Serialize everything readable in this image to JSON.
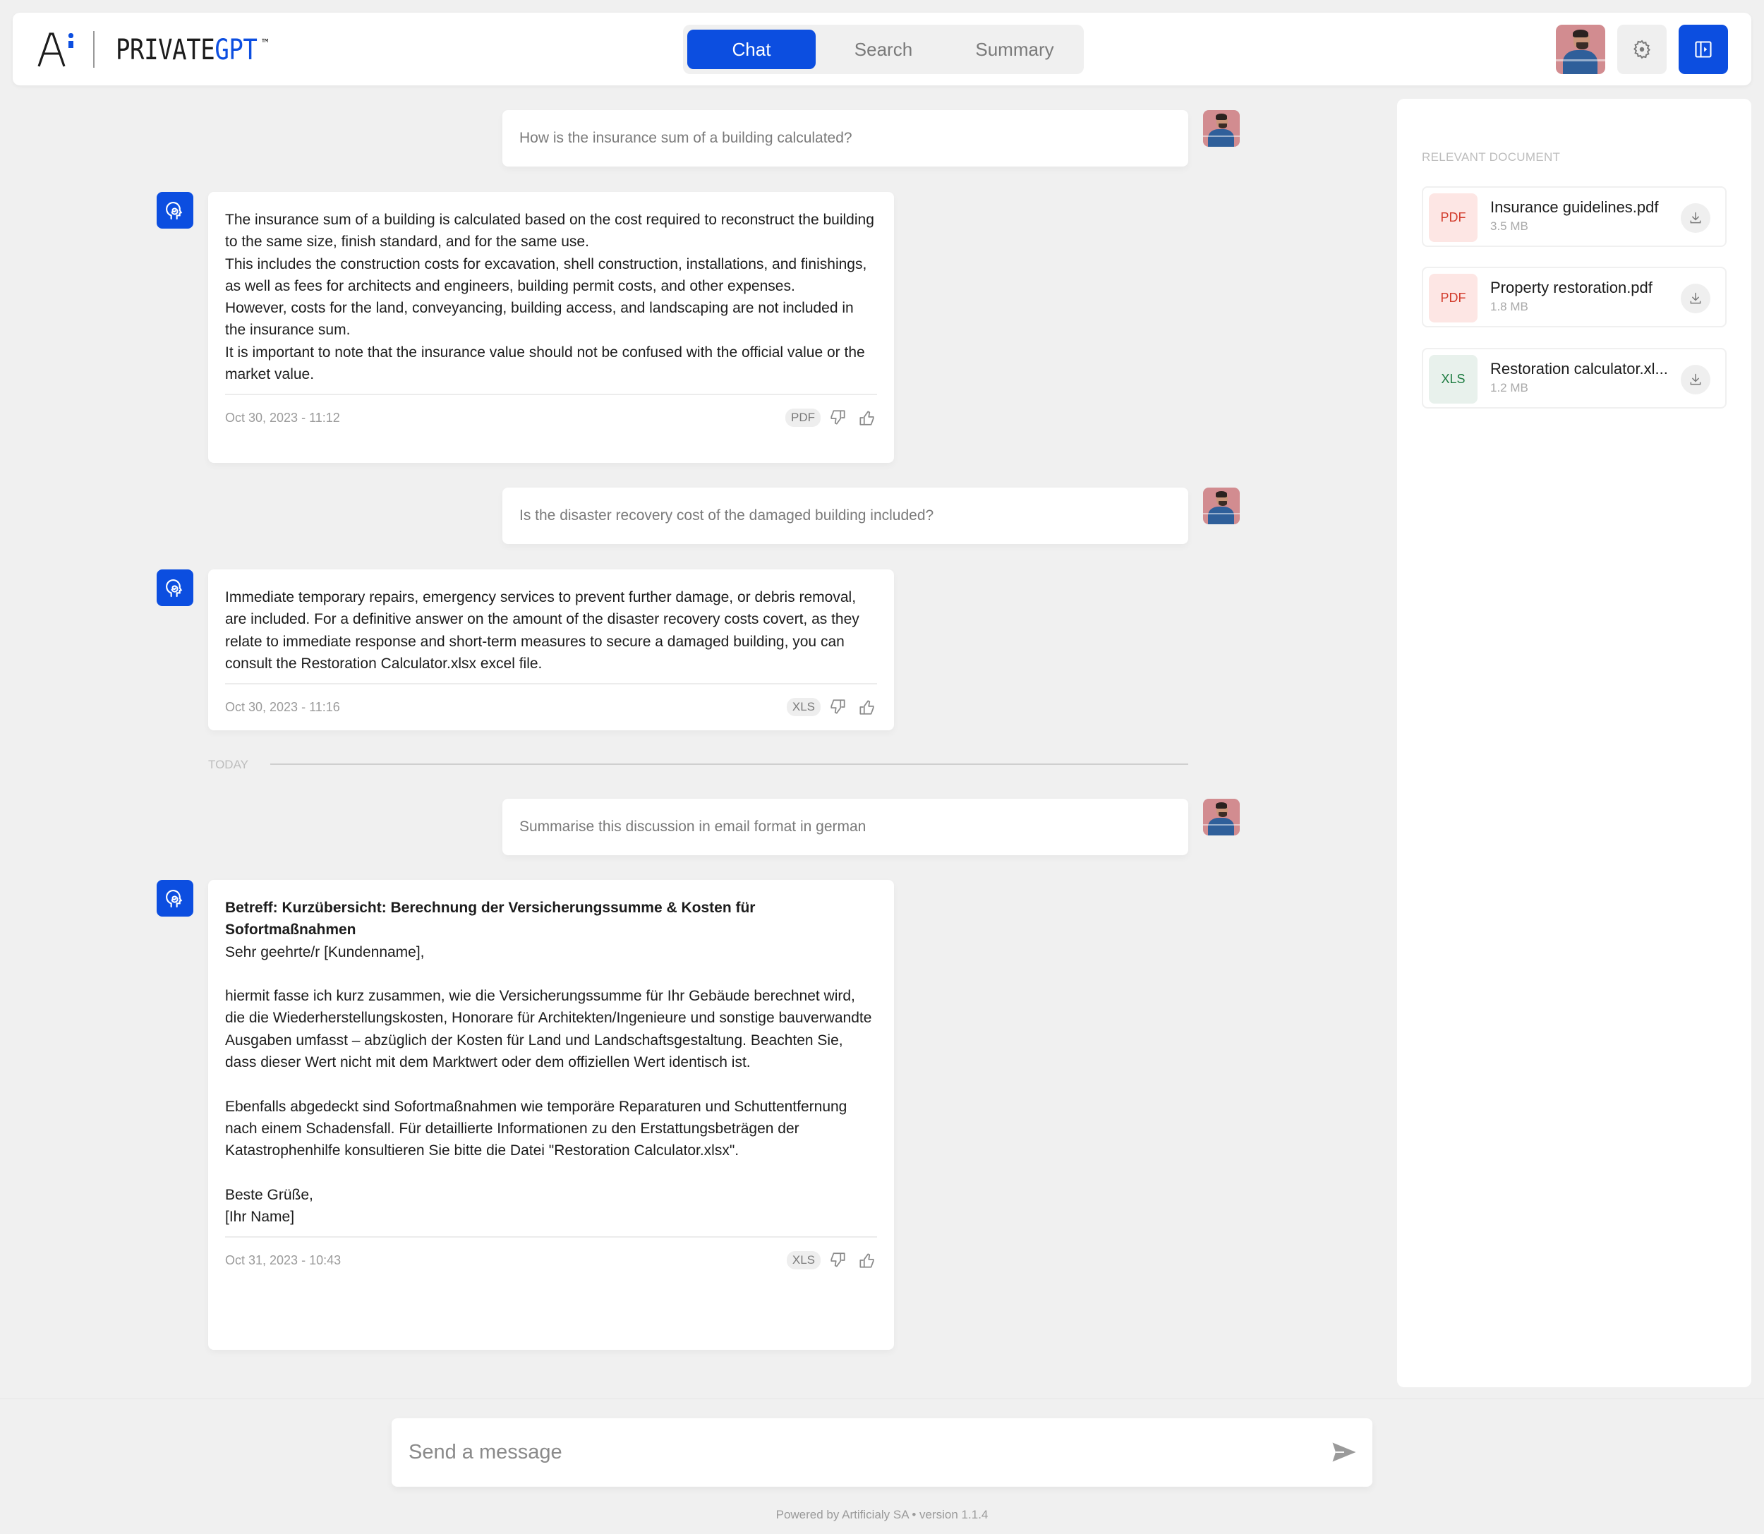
{
  "header": {
    "brand_part1": "PRIVATE",
    "brand_part2": "GPT",
    "brand_tm": "™",
    "tabs": [
      {
        "label": "Chat",
        "active": true
      },
      {
        "label": "Search",
        "active": false
      },
      {
        "label": "Summary",
        "active": false
      }
    ],
    "icons": {
      "settings": "gear-icon",
      "panel": "sidebar-toggle-icon"
    }
  },
  "colors": {
    "accent": "#0c4ee0",
    "background": "#f0f0f0",
    "pdf_bg": "#fde6e4",
    "pdf_text": "#d23a2a",
    "xls_bg": "#e8f1ec",
    "xls_text": "#1a7a3e"
  },
  "messages": [
    {
      "role": "user",
      "text": "How is the insurance sum of a building calculated?"
    },
    {
      "role": "assistant",
      "text": "The insurance sum of a building is calculated based on the cost required to reconstruct the building to the same size, finish standard, and for the same use.\nThis includes the construction costs for excavation, shell construction, installations, and finishings, as well as fees for architects and engineers, building permit costs, and other expenses.\nHowever, costs for the land, conveyancing, building access, and landscaping are not included in the insurance sum.\nIt is important to note that the insurance value should not be confused with the official value or the market value.",
      "timestamp": "Oct 30, 2023 - 11:12",
      "source_badge": "PDF"
    },
    {
      "role": "user",
      "text": "Is the disaster recovery cost of the damaged building included?"
    },
    {
      "role": "assistant",
      "text": "Immediate temporary repairs, emergency services to prevent further damage, or debris removal, are included. For a definitive answer on the amount of the disaster recovery costs covert, as they relate to immediate response and short-term measures to secure a damaged building, you can consult the Restoration Calculator.xlsx excel file.",
      "timestamp": "Oct 30, 2023 - 11:16",
      "source_badge": "XLS"
    },
    {
      "role": "divider",
      "text": "TODAY"
    },
    {
      "role": "user",
      "text": "Summarise this discussion in email format in german"
    },
    {
      "role": "assistant",
      "subject": "Betreff: Kurzübersicht: Berechnung der Versicherungssumme & Kosten für Sofortmaßnahmen",
      "text": "\nSehr geehrte/r [Kundenname],\n\nhiermit fasse ich kurz zusammen, wie die Versicherungssumme für Ihr Gebäude berechnet wird, die die Wiederherstellungskosten, Honorare für Architekten/Ingenieure und sonstige bauverwandte Ausgaben umfasst – abzüglich der Kosten für Land und Landschaftsgestaltung. Beachten Sie, dass dieser Wert nicht mit dem Marktwert oder dem offiziellen Wert identisch ist.\n\nEbenfalls abgedeckt sind Sofortmaßnahmen wie temporäre Reparaturen und Schuttentfernung nach einem Schadensfall. Für detaillierte Informationen zu den Erstattungsbeträgen der Katastrophenhilfe konsultieren Sie bitte die Datei \"Restoration Calculator.xlsx\".\n\nBeste Grüße,\n[Ihr Name]",
      "timestamp": "Oct 31, 2023 - 10:43",
      "source_badge": "XLS"
    }
  ],
  "side_panel": {
    "title": "RELEVANT DOCUMENT",
    "documents": [
      {
        "type": "PDF",
        "name": "Insurance guidelines.pdf",
        "size": "3.5 MB"
      },
      {
        "type": "PDF",
        "name": "Property restoration.pdf",
        "size": "1.8 MB"
      },
      {
        "type": "XLS",
        "name": "Restoration calculator.xl...",
        "size": "1.2 MB"
      }
    ]
  },
  "composer": {
    "placeholder": "Send a message",
    "value": ""
  },
  "footer": {
    "powered_by": "Powered by Artificialy SA • version 1.1.4"
  }
}
